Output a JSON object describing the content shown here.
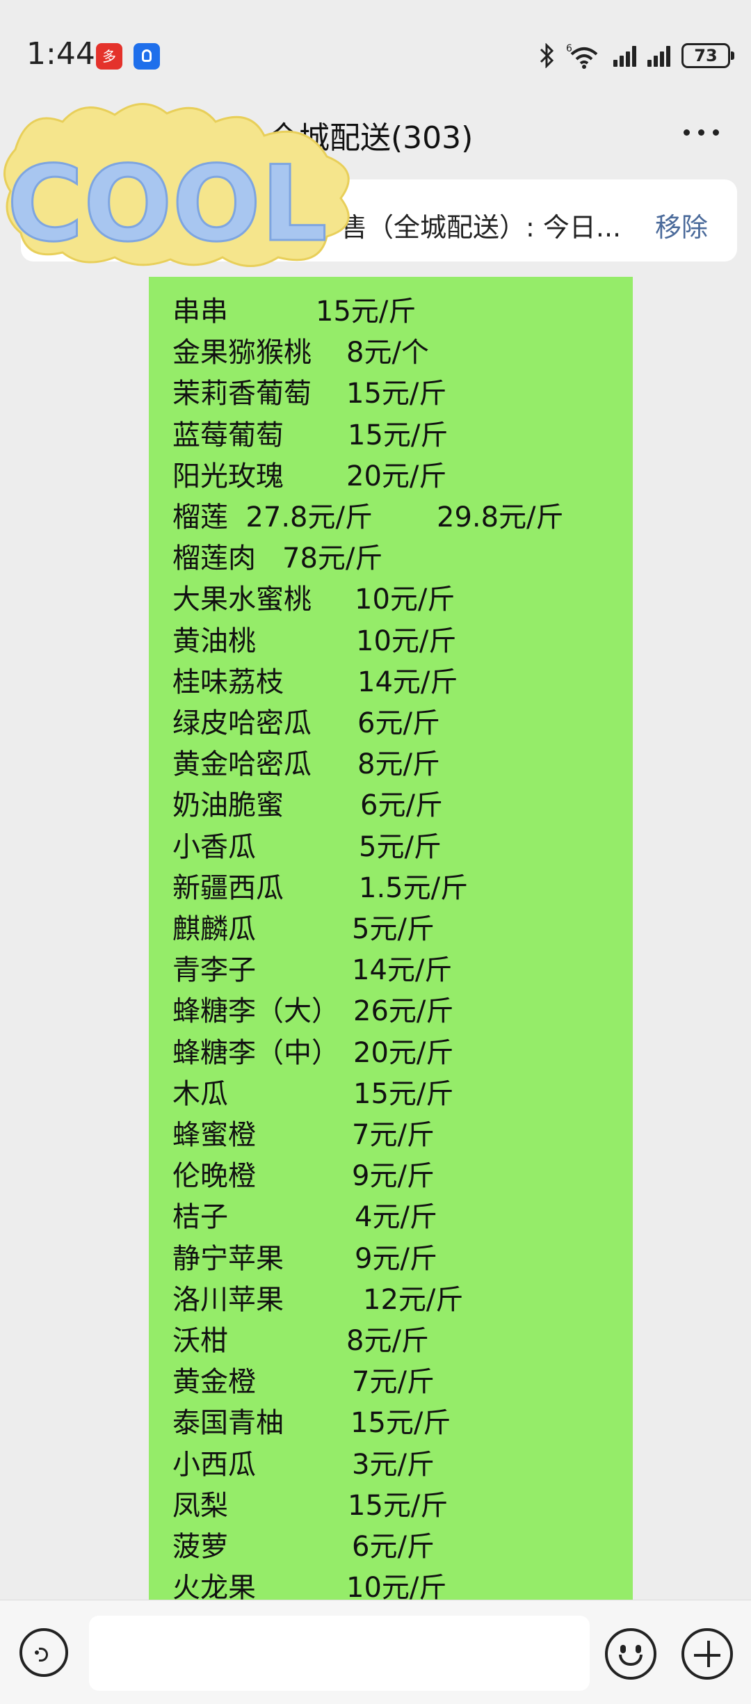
{
  "status_bar": {
    "time": "1:44",
    "battery": "73",
    "wifi_label": "6"
  },
  "header": {
    "title": "售...全城配送(303)"
  },
  "pinned": {
    "text": "售（全城配送）: 今日...",
    "remove_label": "移除"
  },
  "sticker": {
    "text": "COOL"
  },
  "message": {
    "items": [
      {
        "name": "串串",
        "price": "15元/斤"
      },
      {
        "name": "金果猕猴桃",
        "price": "8元/个"
      },
      {
        "name": "茉莉香葡萄",
        "price": "15元/斤"
      },
      {
        "name": "蓝莓葡萄",
        "price": "15元/斤"
      },
      {
        "name": "阳光玫瑰",
        "price": "20元/斤"
      },
      {
        "name": "榴莲  27.8元/斤",
        "price": "29.8元/斤"
      },
      {
        "name": "榴莲肉",
        "price": "78元/斤"
      },
      {
        "name": "大果水蜜桃",
        "price": "10元/斤"
      },
      {
        "name": "黄油桃",
        "price": "10元/斤"
      },
      {
        "name": "桂味荔枝",
        "price": "14元/斤"
      },
      {
        "name": "绿皮哈密瓜",
        "price": "6元/斤"
      },
      {
        "name": "黄金哈密瓜",
        "price": "8元/斤"
      },
      {
        "name": "奶油脆蜜",
        "price": "6元/斤"
      },
      {
        "name": "小香瓜",
        "price": "5元/斤"
      },
      {
        "name": "新疆西瓜",
        "price": "1.5元/斤"
      },
      {
        "name": "麒麟瓜",
        "price": "5元/斤"
      },
      {
        "name": "青李子",
        "price": "14元/斤"
      },
      {
        "name": "蜂糖李（大）",
        "price": "26元/斤"
      },
      {
        "name": "蜂糖李（中）",
        "price": "20元/斤"
      },
      {
        "name": "木瓜",
        "price": "15元/斤"
      },
      {
        "name": "蜂蜜橙",
        "price": "7元/斤"
      },
      {
        "name": "伦晚橙",
        "price": "9元/斤"
      },
      {
        "name": "桔子",
        "price": "4元/斤"
      },
      {
        "name": "静宁苹果",
        "price": "9元/斤"
      },
      {
        "name": "洛川苹果",
        "price": "12元/斤"
      },
      {
        "name": "沃柑",
        "price": "8元/斤"
      },
      {
        "name": "黄金橙",
        "price": "7元/斤"
      },
      {
        "name": "泰国青柚",
        "price": "15元/斤"
      },
      {
        "name": "小西瓜",
        "price": "3元/斤"
      },
      {
        "name": "凤梨",
        "price": "15元/斤"
      },
      {
        "name": "菠萝",
        "price": "6元/斤"
      },
      {
        "name": "火龙果",
        "price": "10元/斤"
      }
    ]
  }
}
